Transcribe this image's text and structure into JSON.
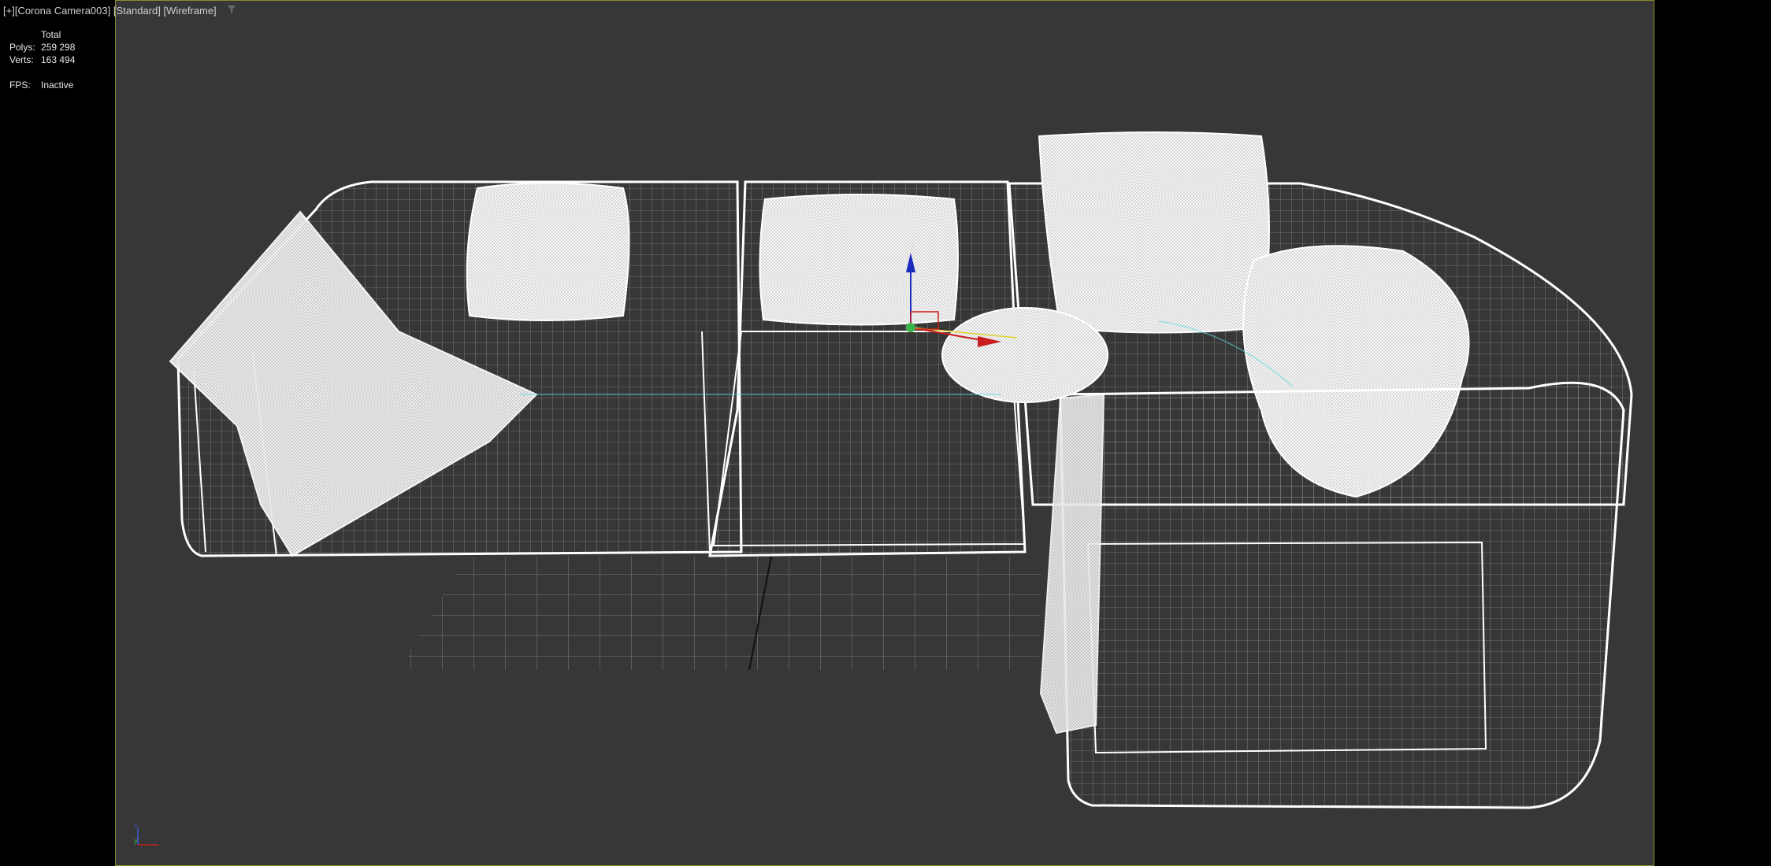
{
  "viewport": {
    "label_plus": "[+]",
    "label_camera": "[Corona Camera003]",
    "label_shading_mode": "[Standard]",
    "label_display_mode": "[Wireframe]",
    "filter_icon": "filter-icon"
  },
  "stats": {
    "total_label": "Total",
    "polys_label": "Polys:",
    "polys_value": "259 298",
    "verts_label": "Verts:",
    "verts_value": "163 494",
    "fps_label": "FPS:",
    "fps_value": "Inactive"
  },
  "axis_tripod": {
    "z_label": "z",
    "y_label": "y"
  },
  "gizmo": {
    "z_label": "z"
  },
  "colors": {
    "viewport_bg": "#373737",
    "viewport_border": "#8e8b2c",
    "wire": "#ffffff",
    "grid": "#9a9a9a",
    "gizmo_x": "#c81e1e",
    "gizmo_y": "#39b548",
    "gizmo_z": "#1a2bbd"
  }
}
